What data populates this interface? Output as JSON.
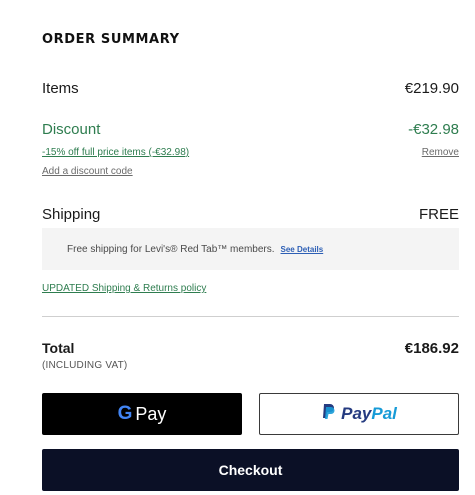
{
  "summary": {
    "title": "ORDER SUMMARY",
    "items_label": "Items",
    "items_value": "€219.90",
    "discount_label": "Discount",
    "discount_value": "-€32.98",
    "promo_link": "-15% off full price items (-€32.98)",
    "remove_label": "Remove",
    "add_code_label": "Add a discount code",
    "shipping_label": "Shipping",
    "shipping_value": "FREE",
    "banner_text": "Free shipping for Levi's® Red Tab™ members.",
    "banner_link": "See Details",
    "policy_link": "UPDATED Shipping & Returns policy",
    "total_label": "Total",
    "total_sub": "(INCLUDING VAT)",
    "total_value": "€186.92"
  },
  "buttons": {
    "gpay_g": "G",
    "gpay_label": "Pay",
    "paypal_a": "Pay",
    "paypal_b": "Pal",
    "checkout_label": "Checkout"
  },
  "colors": {
    "accent_green": "#2e7d4f",
    "checkout_bg": "#0b1026",
    "paypal_dark": "#253b80",
    "paypal_light": "#179bd7"
  },
  "icons": [
    "google-g-icon",
    "paypal-icon"
  ]
}
